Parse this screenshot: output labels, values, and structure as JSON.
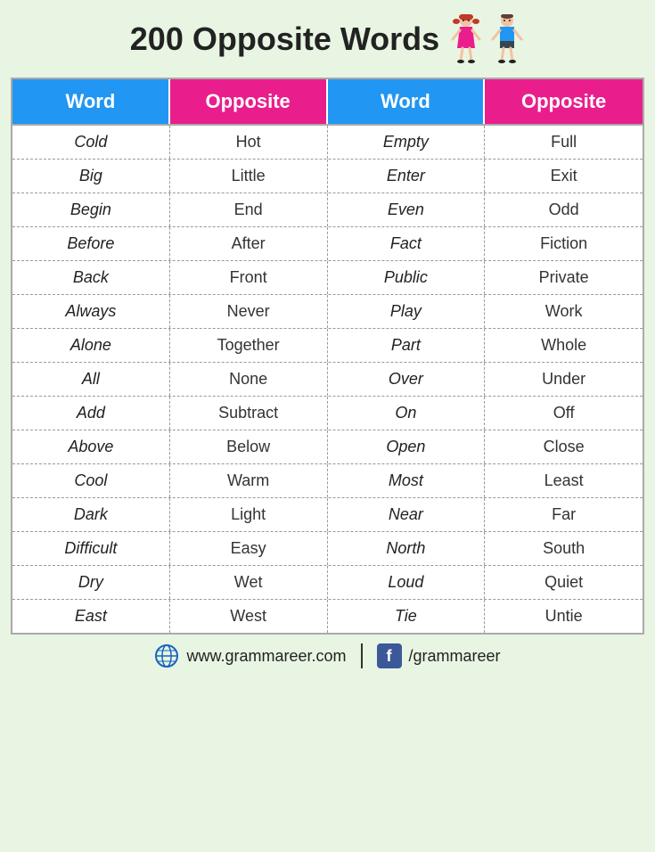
{
  "title": "200 Opposite Words",
  "headers": [
    "Word",
    "Opposite",
    "Word",
    "Opposite"
  ],
  "rows": [
    [
      "Cold",
      "Hot",
      "Empty",
      "Full"
    ],
    [
      "Big",
      "Little",
      "Enter",
      "Exit"
    ],
    [
      "Begin",
      "End",
      "Even",
      "Odd"
    ],
    [
      "Before",
      "After",
      "Fact",
      "Fiction"
    ],
    [
      "Back",
      "Front",
      "Public",
      "Private"
    ],
    [
      "Always",
      "Never",
      "Play",
      "Work"
    ],
    [
      "Alone",
      "Together",
      "Part",
      "Whole"
    ],
    [
      "All",
      "None",
      "Over",
      "Under"
    ],
    [
      "Add",
      "Subtract",
      "On",
      "Off"
    ],
    [
      "Above",
      "Below",
      "Open",
      "Close"
    ],
    [
      "Cool",
      "Warm",
      "Most",
      "Least"
    ],
    [
      "Dark",
      "Light",
      "Near",
      "Far"
    ],
    [
      "Difficult",
      "Easy",
      "North",
      "South"
    ],
    [
      "Dry",
      "Wet",
      "Loud",
      "Quiet"
    ],
    [
      "East",
      "West",
      "Tie",
      "Untie"
    ]
  ],
  "footer": {
    "website": "www.grammareer.com",
    "social": "/grammareer",
    "fb_label": "f"
  }
}
